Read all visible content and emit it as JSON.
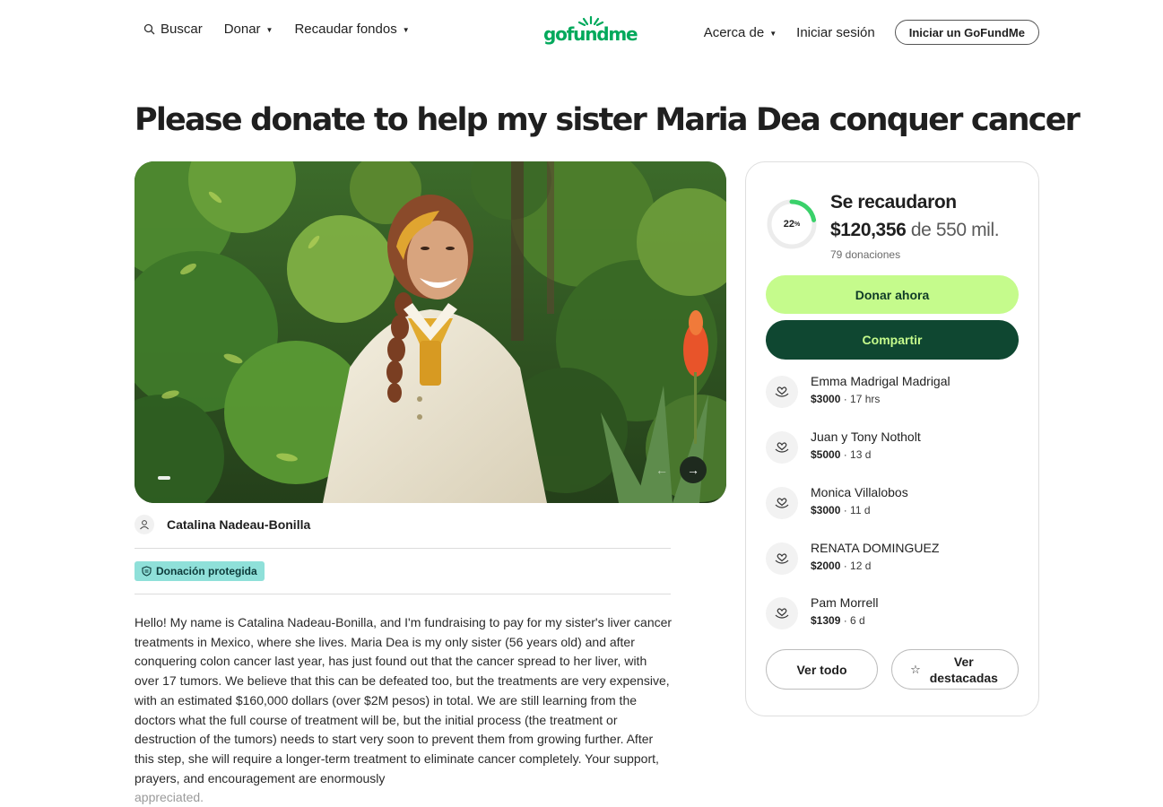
{
  "header": {
    "search_label": "Buscar",
    "donate_label": "Donar",
    "fundraise_label": "Recaudar fondos",
    "logo_text": "gofundme",
    "about_label": "Acerca de",
    "login_label": "Iniciar sesión",
    "start_label": "Iniciar un GoFundMe"
  },
  "campaign": {
    "title": "Please donate to help my sister Maria Dea conquer cancer",
    "organizer": "Catalina Nadeau-Bonilla",
    "badge": "Donación protegida",
    "story": "Hello! My name is Catalina Nadeau-Bonilla, and I'm fundraising to pay for my sister's liver cancer treatments in Mexico, where she lives. Maria Dea is my only sister (56 years old) and after conquering colon cancer last year, has just found out that the cancer spread to her liver, with over 17 tumors. We believe that this can be defeated too, but the treatments are very expensive, with an estimated $160,000 dollars (over $2M pesos) in total. We are still learning from the doctors what the full course of treatment will be, but the initial process (the treatment or destruction of the tumors) needs to start very soon to prevent them from growing further. After this step, she will require a longer-term treatment to eliminate cancer completely. Your support, prayers, and encouragement are enormously",
    "story_tail": "appreciated."
  },
  "progress": {
    "percent": 22,
    "percent_label": "22",
    "percent_sign": "%",
    "raised_label": "Se recaudaron",
    "amount": "$120,356",
    "goal": "de 550 mil.",
    "donations": "79 donaciones"
  },
  "actions": {
    "donate": "Donar ahora",
    "share": "Compartir",
    "see_all": "Ver todo",
    "see_top": "Ver destacadas"
  },
  "donors": [
    {
      "name": "Emma Madrigal Madrigal",
      "amount": "$3000",
      "time": "· 17 hrs"
    },
    {
      "name": "Juan y Tony Notholt",
      "amount": "$5000",
      "time": "· 13 d"
    },
    {
      "name": "Monica Villalobos",
      "amount": "$3000",
      "time": "· 11 d"
    },
    {
      "name": "RENATA DOMINGUEZ",
      "amount": "$2000",
      "time": "· 12 d"
    },
    {
      "name": "Pam Morrell",
      "amount": "$1309",
      "time": "· 6 d"
    }
  ],
  "colors": {
    "brand": "#02a95c",
    "donate_button": "#c5fb8c",
    "share_button": "#0f4731",
    "badge": "#8fe0d9"
  }
}
